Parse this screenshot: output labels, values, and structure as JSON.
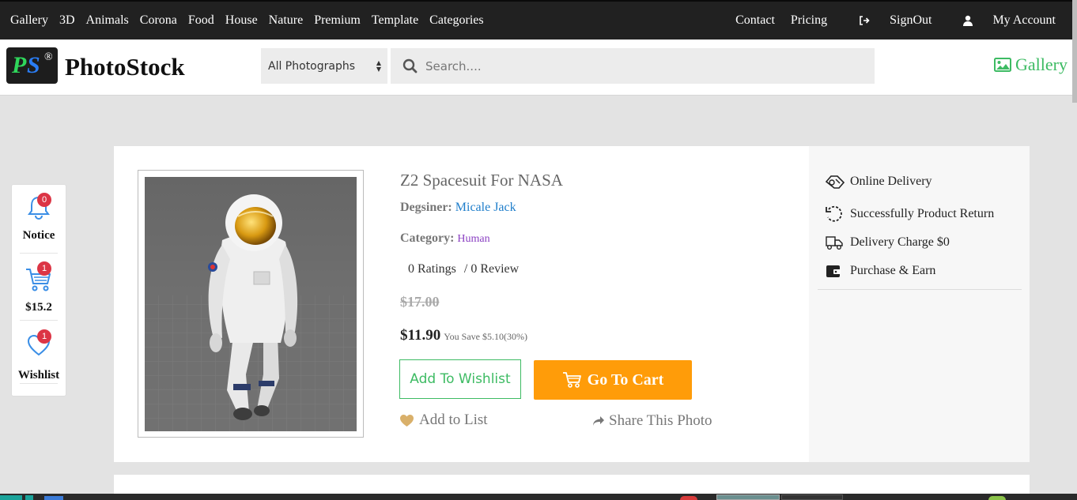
{
  "topnav": {
    "left_items": [
      "Gallery",
      "3D",
      "Animals",
      "Corona",
      "Food",
      "House",
      "Nature",
      "Premium",
      "Template",
      "Categories"
    ],
    "contact": "Contact",
    "pricing": "Pricing",
    "signout": "SignOut",
    "account": "My Account"
  },
  "header": {
    "logo_p": "P",
    "logo_s": "S",
    "logo_reg": "®",
    "brand": "PhotoStock",
    "category_select": "All Photographs",
    "search_placeholder": "Search....",
    "gallery_link": "Gallery"
  },
  "side": {
    "notice": {
      "label": "Notice",
      "count": "0"
    },
    "cart": {
      "label": "$15.2",
      "count": "1"
    },
    "wishlist": {
      "label": "Wishlist",
      "count": "1"
    }
  },
  "product": {
    "title": "Z2 Spacesuit For NASA",
    "designer_label": "Degsiner:",
    "designer_name": "Micale Jack",
    "category_label": "Category:",
    "category_name": "Human",
    "ratings": "0 Ratings",
    "reviews": "/ 0 Review",
    "old_price": "$17.00",
    "new_price": "$11.90",
    "save_text": "You Save $5.10(30%)",
    "wishlist_button": "Add To Wishlist",
    "cart_button": "Go To Cart",
    "add_to_list": "Add to List",
    "share": "Share This Photo"
  },
  "features": [
    {
      "icon": "delivery-handshake-icon",
      "label": "Online Delivery"
    },
    {
      "icon": "return-arrow-icon",
      "label": "Successfully Product Return"
    },
    {
      "icon": "truck-icon",
      "label": "Delivery Charge $0"
    },
    {
      "icon": "wallet-icon",
      "label": "Purchase & Earn"
    }
  ],
  "colors": {
    "accent_green": "#3dbb63",
    "cart_orange": "#ff9c09",
    "badge_red": "#dc3545",
    "nav_dark": "#212121",
    "link_blue": "#1f7ecb"
  }
}
